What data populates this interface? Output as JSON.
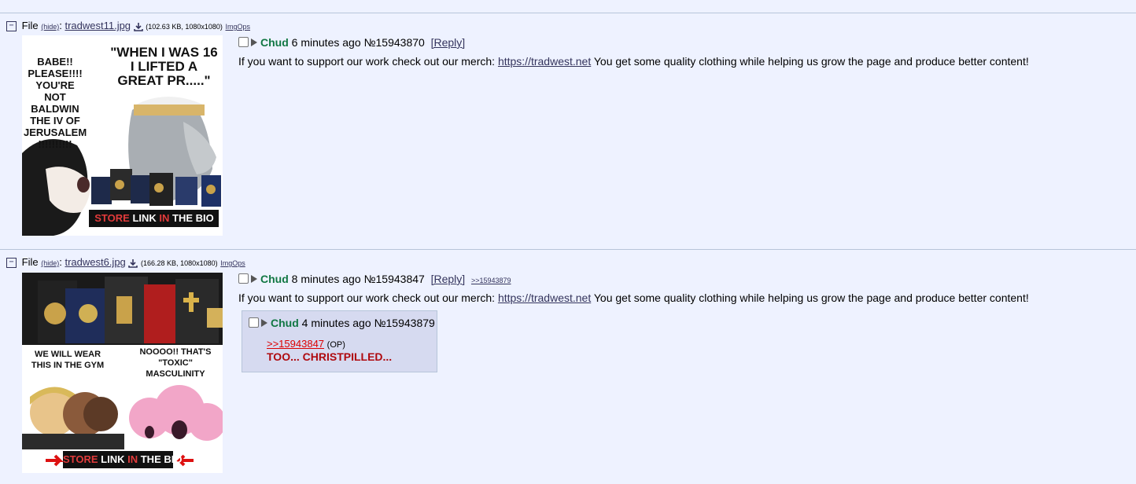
{
  "posts": [
    {
      "file_label": "File",
      "hide_label": "(hide)",
      "filename": "tradwest11.jpg",
      "file_size": "(102.63 KB, 1080x1080)",
      "imgops": "ImgOps",
      "name": "Chud",
      "time": "6 minutes ago",
      "number": "№15943870",
      "reply": "[Reply]",
      "backlink": "",
      "body_before": "If you want to support our work check out our merch: ",
      "body_link": "https://tradwest.net",
      "body_after": " You get some quality clothing while helping us grow the page and produce better content!",
      "thumb": {
        "left_text": "BABE!! PLEASE!!!! YOU'RE NOT BALDWIN THE IV OF JERUSALEM !!!!!!!!!!",
        "right_text": "\"WHEN I WAS 16 I LIFTED A GREAT PR.....\"",
        "banner_store": "STORE ",
        "banner_link": "LINK ",
        "banner_in": "IN",
        "banner_the": " THE BIO"
      }
    },
    {
      "file_label": "File",
      "hide_label": "(hide)",
      "filename": "tradwest6.jpg",
      "file_size": "(166.28 KB, 1080x1080)",
      "imgops": "ImgOps",
      "name": "Chud",
      "time": "8 minutes ago",
      "number": "№15943847",
      "reply": "[Reply]",
      "backlink": ">>15943879",
      "body_before": "If you want to support our work check out our merch: ",
      "body_link": "https://tradwest.net",
      "body_after": " You get some quality clothing while helping us grow the page and produce better content!",
      "thumb": {
        "left_text": "WE WILL WEAR THIS IN THE GYM",
        "right_text": "NOOOO!! THAT'S \"TOXIC\" MASCULINITY",
        "banner_store": "STORE ",
        "banner_link": "LINK ",
        "banner_in": "IN",
        "banner_the": " THE BIO"
      }
    }
  ],
  "reply_post": {
    "name": "Chud",
    "time": "4 minutes ago",
    "number": "№15943879",
    "quote_link": ">>15943847",
    "op_tag": "(OP)",
    "greentext": "TOO... CHRISTPILLED..."
  },
  "colors": {
    "background": "#eef2ff",
    "name": "#117743",
    "reply_bg": "#d6daf0",
    "quote": "#dd0000"
  }
}
